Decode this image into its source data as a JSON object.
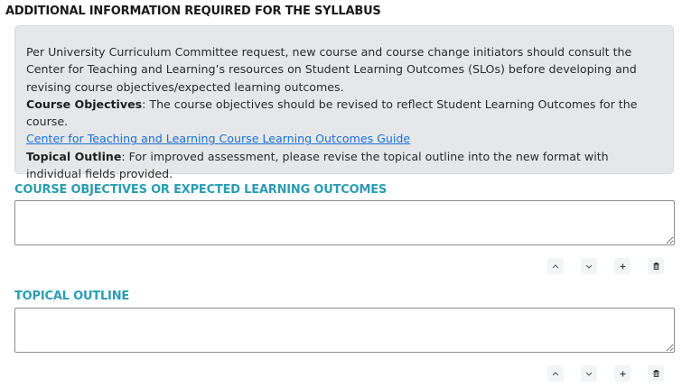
{
  "section": {
    "title": "ADDITIONAL INFORMATION REQUIRED FOR THE SYLLABUS"
  },
  "info": {
    "intro": "Per University Curriculum Committee request, new course and course change initiators should consult the Center for Teaching and Learning’s resources on Student Learning Outcomes (SLOs) before developing and revising course objectives/expected learning outcomes.",
    "objectives_label": "Course Objectives",
    "objectives_text": ": The course objectives should be revised to reflect Student Learning Outcomes for the course.",
    "guide_link": "Center for Teaching and Learning Course Learning Outcomes Guide",
    "outline_label": "Topical Outline",
    "outline_text": ": For improved assessment, please revise the topical outline into the new format with individual fields provided."
  },
  "fields": [
    {
      "label": "COURSE OBJECTIVES OR EXPECTED LEARNING OUTCOMES",
      "value": ""
    },
    {
      "label": "TOPICAL OUTLINE",
      "value": ""
    }
  ],
  "controls": {
    "icons": [
      "chevron-up-icon",
      "chevron-down-icon",
      "plus-icon",
      "trash-icon"
    ],
    "glyphs": [
      "^",
      "v",
      "+",
      "trash"
    ]
  },
  "colors": {
    "accent": "#2a9db3",
    "link": "#1a6fd4",
    "info_bg": "#e6e7e8"
  }
}
